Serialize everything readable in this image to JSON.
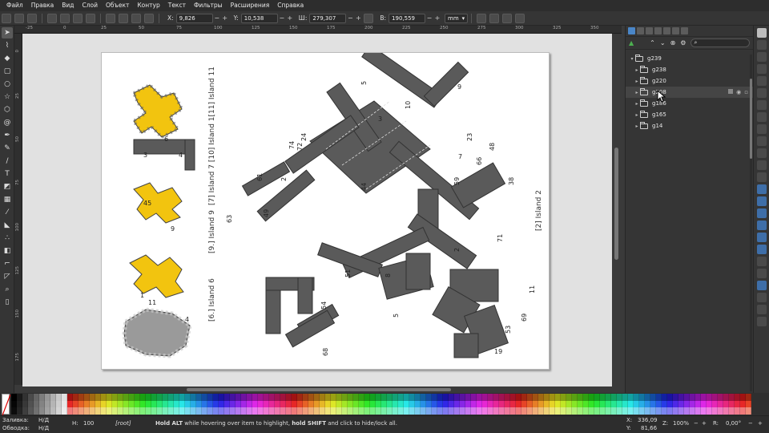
{
  "menu": [
    "Файл",
    "Правка",
    "Вид",
    "Слой",
    "Объект",
    "Контур",
    "Текст",
    "Фильтры",
    "Расширения",
    "Справка"
  ],
  "toolbar": {
    "x_label": "X:",
    "x_value": "9,826",
    "y_label": "Y:",
    "y_value": "10,538",
    "w_label": "Ш:",
    "w_value": "279,307",
    "h_label": "В:",
    "h_value": "190,559",
    "unit": "mm"
  },
  "ruler_top": [
    "-25",
    "0",
    "25",
    "50",
    "75",
    "100",
    "125",
    "150",
    "175",
    "200",
    "225",
    "250",
    "275",
    "300",
    "325",
    "350"
  ],
  "ruler_left": [
    "0",
    "25",
    "50",
    "75",
    "100",
    "125",
    "150",
    "175"
  ],
  "layers": {
    "root": "g239",
    "children": [
      "g238",
      "g220",
      "g208",
      "g186",
      "g165",
      "g14"
    ]
  },
  "canvas": {
    "island_labels": [
      "[2] Island 2",
      "[6.] Island 6",
      "[9.] Island 9",
      "[7] Island 7 [10] Island 1[11] Island 11"
    ],
    "edge_numbers": [
      "5",
      "9",
      "10",
      "3",
      "7",
      "2",
      "38",
      "51",
      "19",
      "54",
      "69",
      "68",
      "23",
      "59",
      "5",
      "61",
      "49",
      "66",
      "4",
      "1",
      "3",
      "11",
      "8",
      "24",
      "63",
      "45",
      "11",
      "6",
      "4",
      "48",
      "44",
      "72",
      "2",
      "71",
      "74",
      "9",
      "53"
    ]
  },
  "status": {
    "fill_label": "Заливка:",
    "fill_value": "Н/Д",
    "stroke_label": "Обводка:",
    "stroke_value": "Н/Д",
    "h_label": "Н:",
    "h_value": "100",
    "layer": "[root]",
    "hint_b1": "Hold ALT",
    "hint_t1": " while hovering over item to highlight, ",
    "hint_b2": "hold SHIFT",
    "hint_t2": " and click to hide/lock all.",
    "x_label": "X:",
    "x_value": "336,09",
    "y_label": "Y:",
    "y_value": "81,66",
    "z_label": "Z:",
    "z_value": "100%",
    "r_label": "R:",
    "r_value": "0,00°"
  },
  "colors": {
    "island_yellow": "#f2c40f",
    "island_gray": "#9a9a9a",
    "shape_dark": "#585858",
    "accent": "#4a86c8"
  }
}
